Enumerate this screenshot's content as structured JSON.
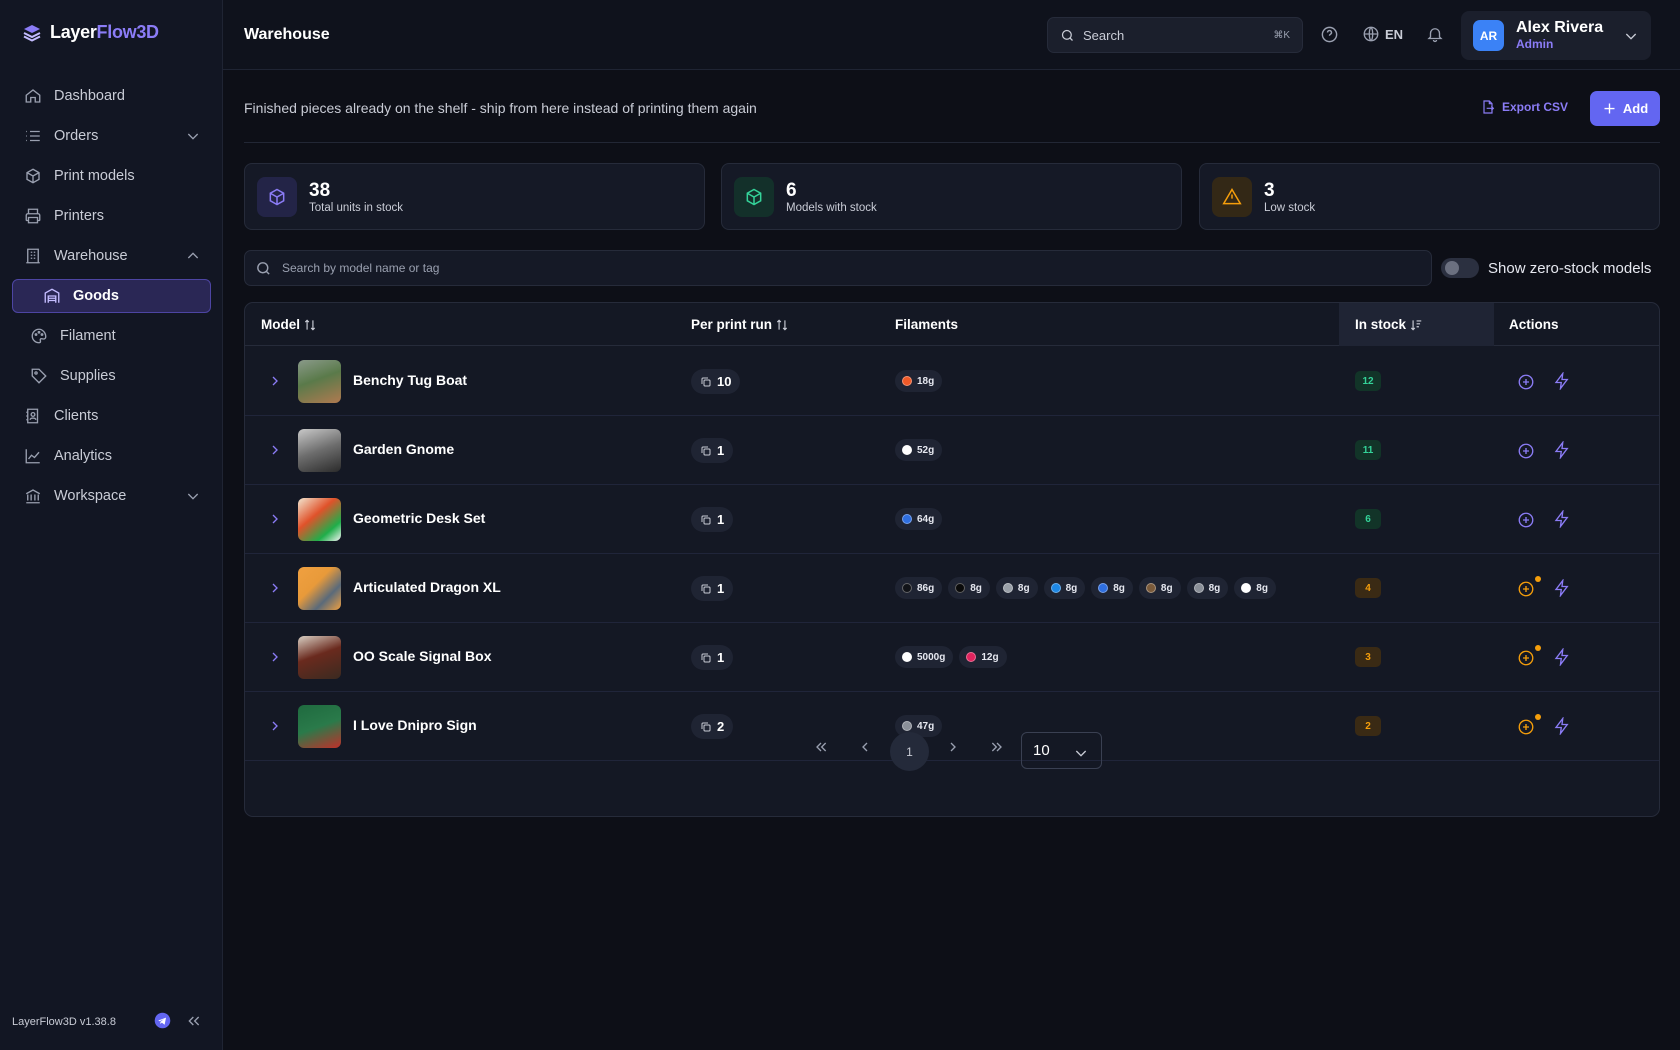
{
  "app": {
    "name_part1": "Layer",
    "name_part2": "Flow3D",
    "version": "LayerFlow3D v1.38.8"
  },
  "sidebar": {
    "items": [
      {
        "label": "Dashboard",
        "icon": "home-icon"
      },
      {
        "label": "Orders",
        "icon": "list-icon",
        "expandable": true
      },
      {
        "label": "Print models",
        "icon": "cube-icon"
      },
      {
        "label": "Printers",
        "icon": "printer-icon"
      },
      {
        "label": "Warehouse",
        "icon": "building-icon",
        "expanded": true
      },
      {
        "label": "Goods",
        "icon": "warehouse-icon",
        "active": true
      },
      {
        "label": "Filament",
        "icon": "palette-icon"
      },
      {
        "label": "Supplies",
        "icon": "tag-icon"
      },
      {
        "label": "Clients",
        "icon": "contacts-icon"
      },
      {
        "label": "Analytics",
        "icon": "chart-line-icon"
      },
      {
        "label": "Workspace",
        "icon": "bank-icon",
        "expandable": true
      }
    ]
  },
  "header": {
    "title": "Warehouse",
    "search_placeholder": "Search",
    "search_shortcut": "⌘K",
    "language": "EN",
    "user": {
      "initials": "AR",
      "name": "Alex Rivera",
      "role": "Admin"
    }
  },
  "page": {
    "subtitle": "Finished pieces already on the shelf - ship from here instead of printing them again",
    "export_label": "Export CSV",
    "add_label": "Add"
  },
  "stats": [
    {
      "value": "38",
      "label": "Total units in stock",
      "icon": "box-icon",
      "color": "#8b7cf6"
    },
    {
      "value": "6",
      "label": "Models with stock",
      "icon": "box-icon",
      "color": "#34d399"
    },
    {
      "value": "3",
      "label": "Low stock",
      "icon": "warning-icon",
      "color": "#f59e0b"
    }
  ],
  "filter": {
    "search_placeholder": "Search by model name or tag",
    "toggle_label": "Show zero-stock models"
  },
  "table": {
    "columns": {
      "model": "Model",
      "per_run": "Per print run",
      "filaments": "Filaments",
      "in_stock": "In stock",
      "actions": "Actions"
    },
    "rows": [
      {
        "name": "Benchy Tug Boat",
        "per_run": "10",
        "stock": "12",
        "low": false,
        "filaments": [
          {
            "color": "#f05a28",
            "g": "18g"
          }
        ]
      },
      {
        "name": "Garden Gnome",
        "per_run": "1",
        "stock": "11",
        "low": false,
        "filaments": [
          {
            "color": "#ffffff",
            "g": "52g"
          }
        ]
      },
      {
        "name": "Geometric Desk Set",
        "per_run": "1",
        "stock": "6",
        "low": false,
        "filaments": [
          {
            "color": "#2f6fe0",
            "g": "64g"
          }
        ]
      },
      {
        "name": "Articulated Dragon XL",
        "per_run": "1",
        "stock": "4",
        "low": true,
        "filaments": [
          {
            "color": "#111318",
            "g": "86g"
          },
          {
            "color": "#0a0a0a",
            "g": "8g"
          },
          {
            "color": "#9aa0a8",
            "g": "8g"
          },
          {
            "color": "#1e88e5",
            "g": "8g"
          },
          {
            "color": "#2f6fe0",
            "g": "8g"
          },
          {
            "color": "#7a5a3a",
            "g": "8g"
          },
          {
            "color": "#8a8f98",
            "g": "8g"
          },
          {
            "color": "#ffffff",
            "g": "8g"
          }
        ]
      },
      {
        "name": "OO Scale Signal Box",
        "per_run": "1",
        "stock": "3",
        "low": true,
        "filaments": [
          {
            "color": "#ffffff",
            "g": "5000g"
          },
          {
            "color": "#e0245e",
            "g": "12g"
          }
        ]
      },
      {
        "name": "I Love Dnipro Sign",
        "per_run": "2",
        "stock": "2",
        "low": true,
        "filaments": [
          {
            "color": "#8a8f98",
            "g": "47g"
          }
        ]
      }
    ]
  },
  "pagination": {
    "current": "1",
    "page_size": "10"
  }
}
